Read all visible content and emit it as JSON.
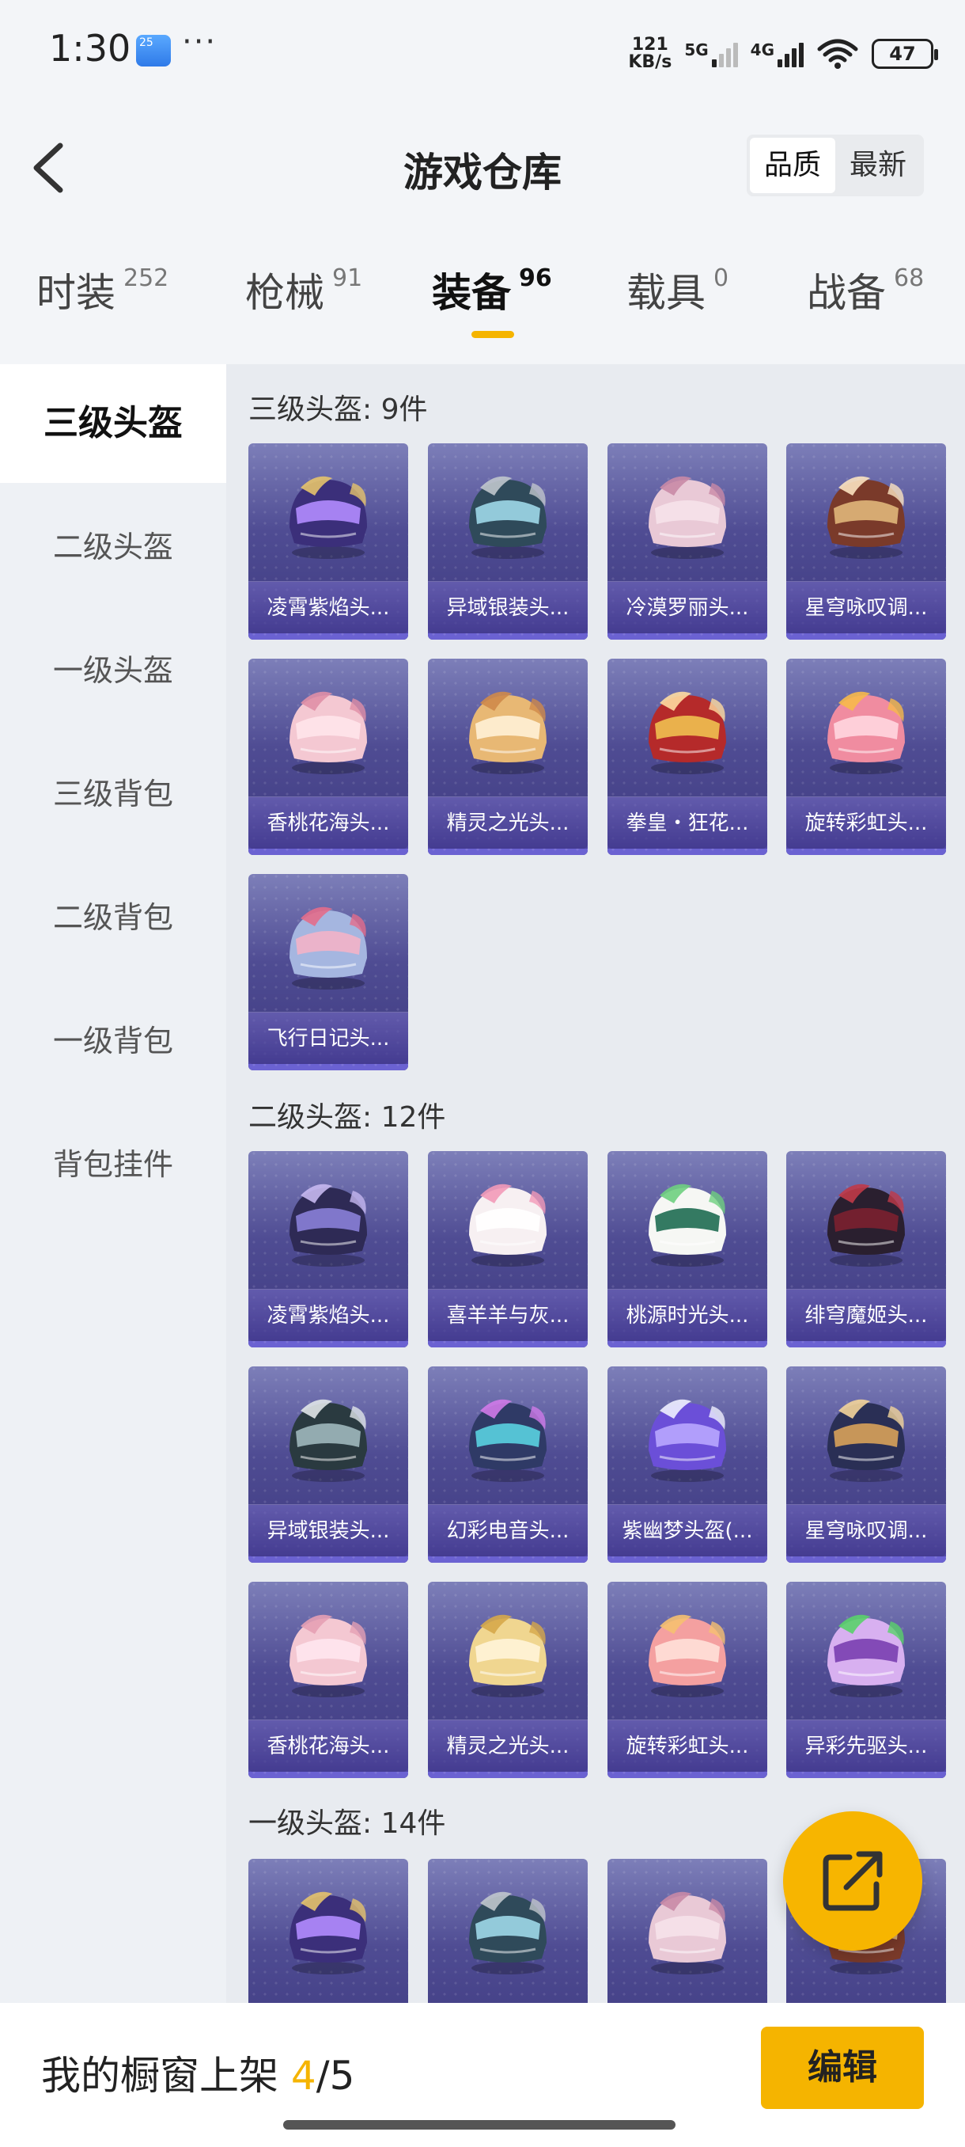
{
  "status_bar": {
    "time": "1:30",
    "weather_badge": "25",
    "more": "···",
    "speed_value": "121",
    "speed_unit": "KB/s",
    "net1": "5G",
    "net2": "4G",
    "battery": "47"
  },
  "header": {
    "title": "游戏仓库",
    "sort_options": [
      "品质",
      "最新"
    ],
    "sort_selected": "品质"
  },
  "tabs": [
    {
      "label": "时装",
      "count": "252"
    },
    {
      "label": "枪械",
      "count": "91"
    },
    {
      "label": "装备",
      "count": "96"
    },
    {
      "label": "载具",
      "count": "0"
    },
    {
      "label": "战备",
      "count": "68"
    }
  ],
  "active_tab": "装备",
  "sidebar": {
    "items": [
      "三级头盔",
      "二级头盔",
      "一级头盔",
      "三级背包",
      "二级背包",
      "一级背包",
      "背包挂件"
    ],
    "active": "三级头盔"
  },
  "sections": [
    {
      "title": "三级头盔: 9件",
      "items": [
        "凌霄紫焰头...",
        "异域银装头...",
        "冷漠罗丽头...",
        "星穹咏叹调...",
        "香桃花海头...",
        "精灵之光头...",
        "拳皇・狂花...",
        "旋转彩虹头...",
        "飞行日记头..."
      ]
    },
    {
      "title": "二级头盔: 12件",
      "items": [
        "凌霄紫焰头...",
        "喜羊羊与灰...",
        "桃源时光头...",
        "绯穹魔姬头...",
        "异域银装头...",
        "幻彩电音头...",
        "紫幽梦头盔(...",
        "星穹咏叹调...",
        "香桃花海头...",
        "精灵之光头...",
        "旋转彩虹头...",
        "异彩先驱头..."
      ]
    },
    {
      "title": "一级头盔: 14件",
      "items": [
        "",
        "",
        "",
        ""
      ]
    }
  ],
  "bottom_bar": {
    "label": "我的橱窗上架",
    "current": "4",
    "total": "/5",
    "edit_label": "编辑"
  },
  "colors": {
    "accent": "#f5b400",
    "card_bg": "#4f4c93",
    "card_stripe": "#6b62d2"
  },
  "icons": {
    "back": "chevron-left-icon",
    "fab": "share-external-icon"
  }
}
